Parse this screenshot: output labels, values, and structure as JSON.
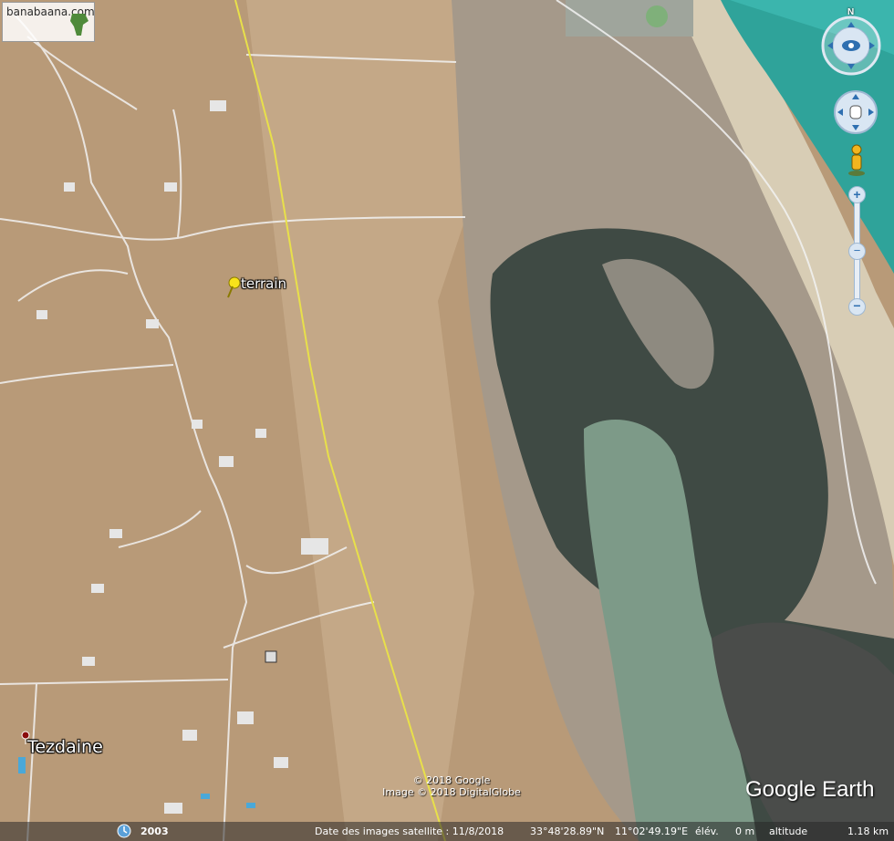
{
  "branding": {
    "site_logo": "banabaana.com",
    "product_logo": "Google Earth"
  },
  "placemarks": [
    {
      "label": "terrain",
      "icon": "yellow-pushpin-icon"
    },
    {
      "label": "Tezdaine",
      "icon": "red-dot-icon"
    }
  ],
  "attribution": {
    "line1": "© 2018 Google",
    "line2": "Image © 2018 DigitalGlobe"
  },
  "statusbar": {
    "historical_year": "2003",
    "imagery_date": "Date des images satellite : 11/8/2018",
    "lat": "33°48'28.89\"N",
    "lon": "11°02'49.19\"E",
    "elevation_label": "élév.",
    "elevation_value": "0 m",
    "altitude_label": "altitude",
    "altitude_value": "1.18 km"
  },
  "navigation": {
    "compass_north": "N",
    "zoom_in": "+",
    "zoom_out": "−"
  },
  "colors": {
    "land": "#b89a78",
    "lagoon_dark": "#3f4a44",
    "lagoon_green": "#7d9a88",
    "sea": "#2fa39a",
    "road": "#f2f2f2",
    "boundary": "#e8e04a"
  }
}
